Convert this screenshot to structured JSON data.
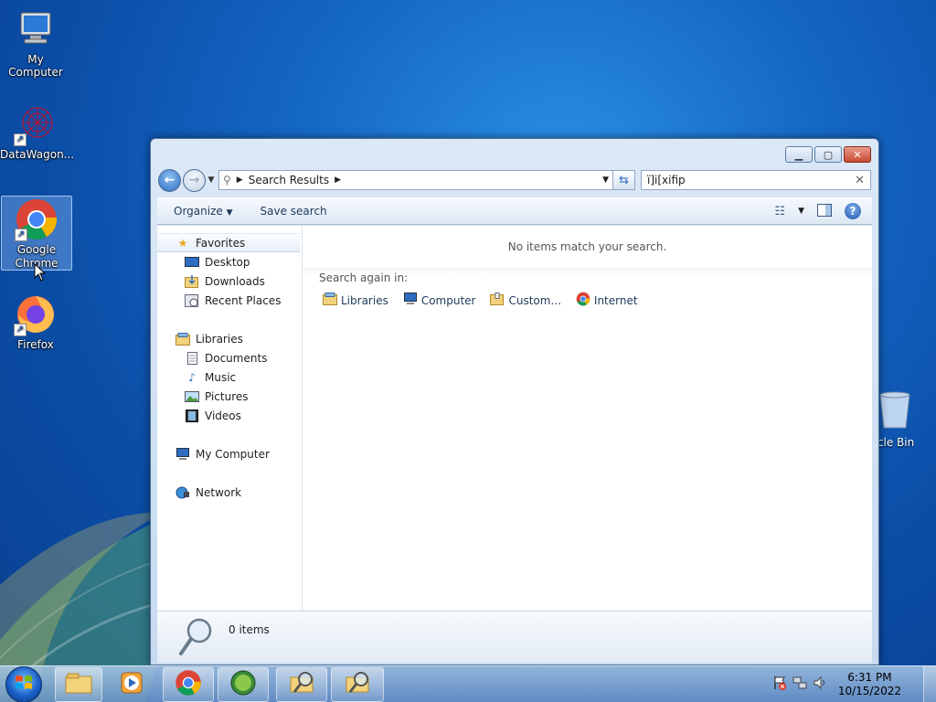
{
  "desktop": {
    "icons": [
      {
        "label": "My Computer",
        "icon": "computer-icon"
      },
      {
        "label": "DataWagon...",
        "icon": "datawagon-icon"
      },
      {
        "label": "Google Chrome",
        "icon": "chrome-icon"
      },
      {
        "label": "Firefox",
        "icon": "firefox-icon"
      }
    ],
    "recycle_bin": {
      "label": "Recycle Bin",
      "icon": "recycle-bin-icon"
    }
  },
  "window": {
    "controls": {
      "minimize": "minimize-icon",
      "maximize": "maximize-icon",
      "close": "close-icon"
    },
    "address": {
      "crumb": "Search Results"
    },
    "search": {
      "value": "ï]i[xifip"
    },
    "toolbar": {
      "organize": "Organize",
      "save_search": "Save search",
      "view_icon": "view-options-icon",
      "preview_icon": "preview-pane-icon",
      "help_icon": "help-icon"
    },
    "nav": {
      "favorites": {
        "label": "Favorites",
        "items": [
          "Desktop",
          "Downloads",
          "Recent Places"
        ]
      },
      "libraries": {
        "label": "Libraries",
        "items": [
          "Documents",
          "Music",
          "Pictures",
          "Videos"
        ]
      },
      "computer": "My Computer",
      "network": "Network"
    },
    "results": {
      "empty_message": "No items match your search.",
      "search_again_label": "Search again in:",
      "locations": [
        "Libraries",
        "Computer",
        "Custom...",
        "Internet"
      ]
    },
    "details": {
      "count": "0 items"
    }
  },
  "taskbar": {
    "clock_time": "6:31 PM",
    "clock_date": "10/15/2022"
  },
  "colors": {
    "accent": "#2f6dc2",
    "window_frame": "#c7daf0",
    "close": "#c74a32"
  }
}
